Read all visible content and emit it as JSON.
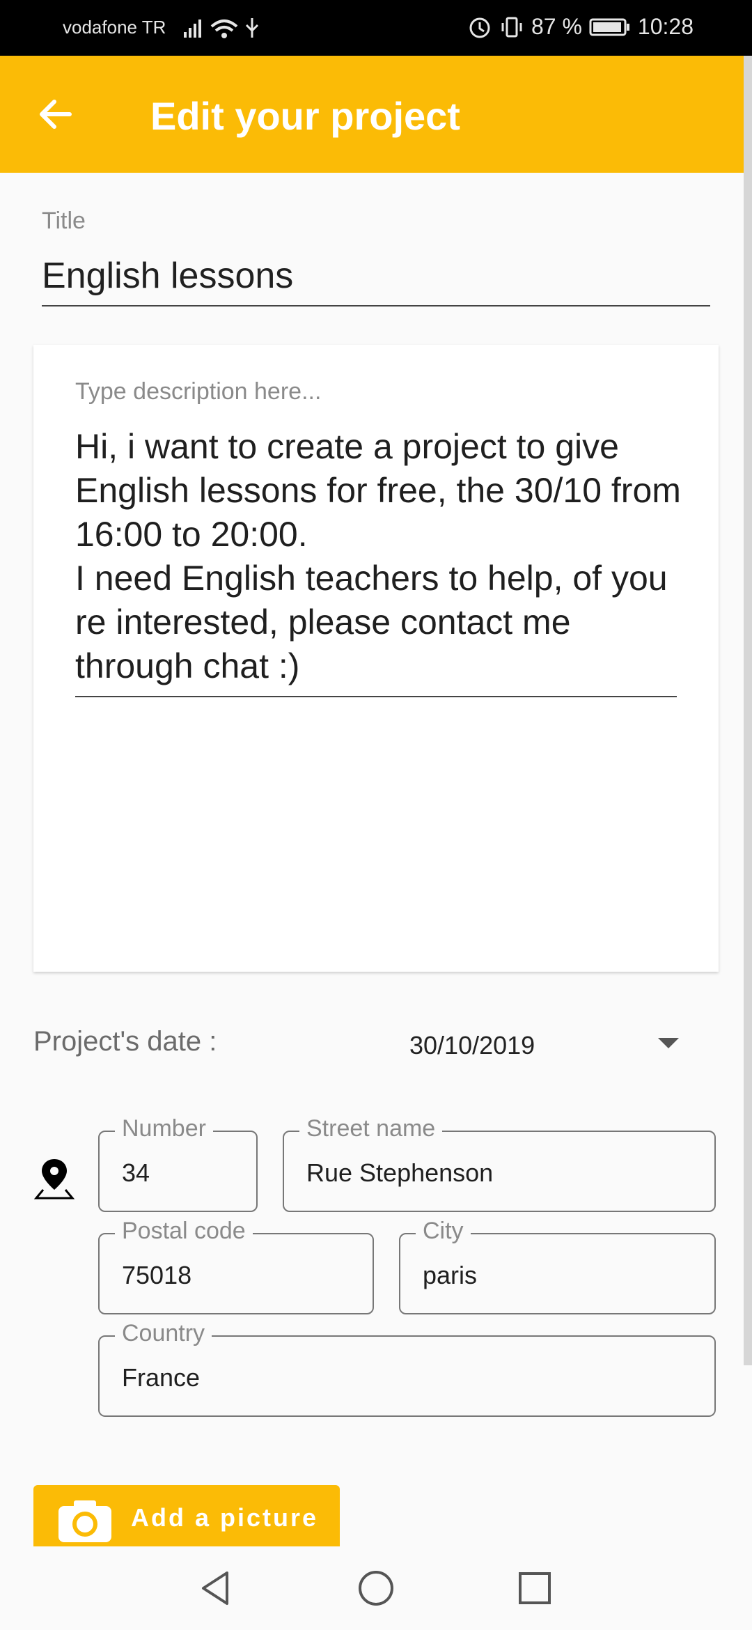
{
  "status_bar": {
    "carrier": "vodafone TR",
    "battery": "87 %",
    "time": "10:28"
  },
  "app_bar": {
    "title": "Edit your project"
  },
  "form": {
    "title_label": "Title",
    "title_value": "English lessons",
    "description_placeholder": "Type description here...",
    "description_value": "Hi, i want to create a project to give English lessons for free, the 30/10 from 16:00 to 20:00.\nI need English teachers to help, of you re interested, please contact me through chat :)",
    "date_label": "Project's date :",
    "date_value": "30/10/2019",
    "address": {
      "number_label": "Number",
      "number_value": "34",
      "street_label": "Street name",
      "street_value": "Rue Stephenson",
      "postal_label": "Postal code",
      "postal_value": "75018",
      "city_label": "City",
      "city_value": "paris",
      "country_label": "Country",
      "country_value": "France"
    },
    "add_picture_label": "Add a picture"
  },
  "colors": {
    "accent": "#fbbb06",
    "status_bar": "#000000"
  },
  "icons": {
    "back": "arrow-left-icon",
    "location": "map-pin-icon",
    "camera": "camera-icon"
  }
}
